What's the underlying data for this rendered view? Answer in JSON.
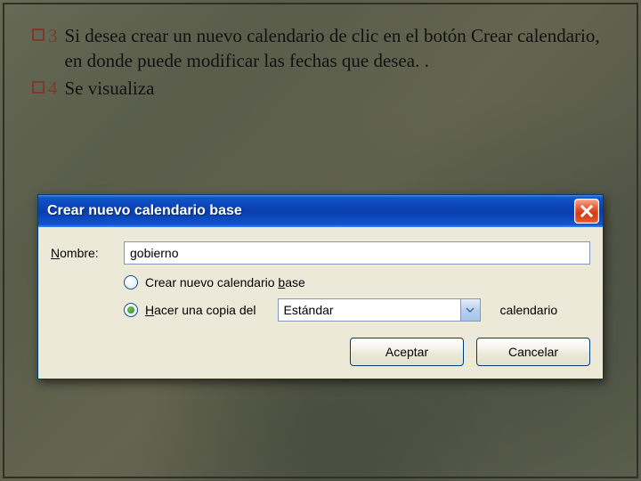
{
  "bullets": [
    {
      "num": "3",
      "text": "Si desea crear un nuevo calendario de clic en el botón  Crear calendario, en donde puede modificar las fechas que desea. ."
    },
    {
      "num": "4",
      "text": "Se visualiza"
    }
  ],
  "dialog": {
    "title": "Crear nuevo calendario base",
    "name_label_pre": "N",
    "name_label_post": "ombre:",
    "name_value": "gobierno",
    "radio1_pre": "Crear nuevo calendario ",
    "radio1_u": "b",
    "radio1_post": "ase",
    "radio2_u": "H",
    "radio2_post": "acer una copia del",
    "combo_value": "Estándar",
    "suffix": "calendario",
    "ok": "Aceptar",
    "cancel": "Cancelar"
  }
}
